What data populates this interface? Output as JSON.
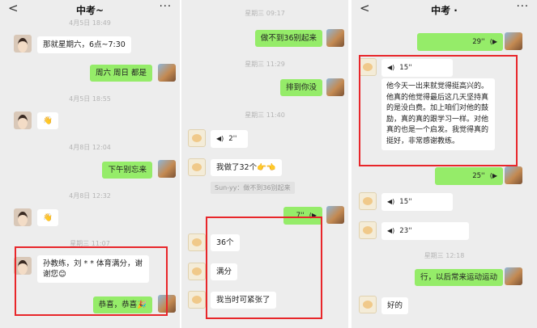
{
  "panel1": {
    "header": {
      "back": "<",
      "title": "中考~",
      "more": "···"
    },
    "ts1": "4月5日 18:49",
    "msg1": "那就星期六，6点~7:30",
    "msg2": "周六  周日  都是",
    "ts2": "4月5日 18:55",
    "msg3": "👋",
    "ts3": "4月8日 12:04",
    "msg4": "下午别忘来",
    "ts4": "4月8日 12:32",
    "msg5": "👋",
    "ts5": "星期三 11:07",
    "msg6": "孙教练，刘 * * 体育满分，谢谢您😊",
    "msg7": "恭喜，恭喜🎉"
  },
  "panel2": {
    "ts1": "星期三 09:17",
    "msg1": "做不到36别起来",
    "ts2": "星期三 11:29",
    "msg2": "排到你没",
    "ts3": "星期三 11:40",
    "voice1_icon": "◀)",
    "voice1": "2''",
    "msg3": "我做了32个👉👈",
    "quote": "Sun-yy：做不到36别起来",
    "voice2_icon": "(▶",
    "voice2": "7''",
    "msg4": "36个",
    "msg5": "满分",
    "msg6": "我当时可紧张了"
  },
  "panel3": {
    "header": {
      "back": "<",
      "title": "中考 ·",
      "more": "···"
    },
    "voice1": "29''",
    "voice1_icon": "(▶",
    "voice2_icon": "◀)",
    "voice2": "15''",
    "transcript": "他今天一出来就觉得挺高兴的。他真的他觉得最后这几天坚持真的是没白费。加上咱们对他的鼓励，真的真的跟学习一样。对他真的也是一个启发。我觉得真的挺好，非常感谢教练。",
    "voice3": "25''",
    "voice3_icon": "(▶",
    "voice4_icon": "◀)",
    "voice4": "15''",
    "voice5_icon": "◀)",
    "voice5": "23''",
    "ts1": "星期三 12:18",
    "msg1": "行，以后常来运动运动",
    "msg2": "好的"
  },
  "colors": {
    "outgoing": "#95ec69",
    "incoming": "#ffffff",
    "background": "#ededed",
    "highlight": "#e8262a"
  }
}
